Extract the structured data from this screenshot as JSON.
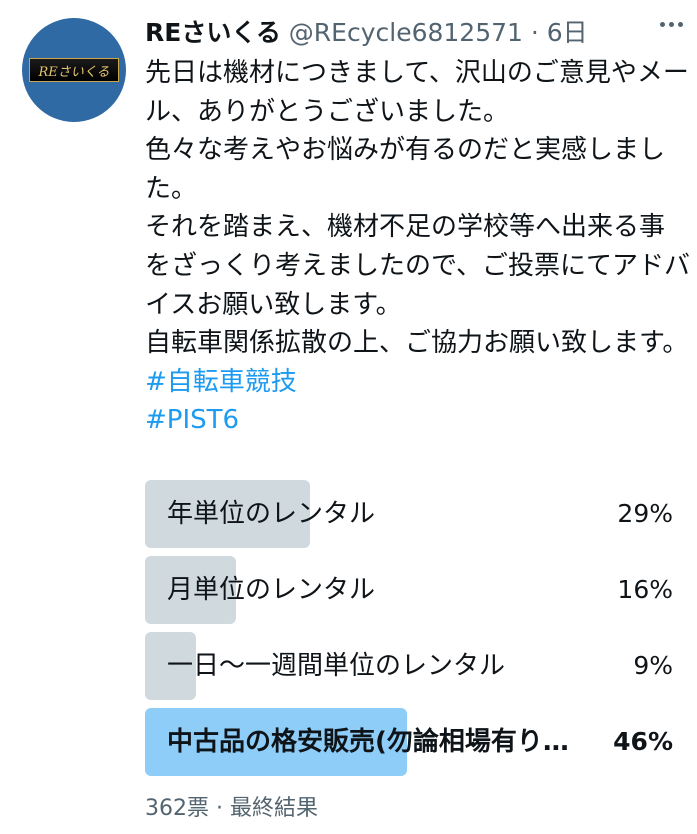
{
  "tweet": {
    "author_name": "REさいくる",
    "handle": "@REcycle6812571",
    "separator": " · ",
    "time": "6日",
    "avatar_text": "REさいくる",
    "paragraphs": [
      "先日は機材につきまして、沢山のご意見やメール、ありがとうございました。",
      "色々な考えやお悩みが有るのだと実感しました。",
      "それを踏まえ、機材不足の学校等へ出来る事をざっくり考えましたので、ご投票にてアドバイスお願い致します。",
      "自転車関係拡散の上、ご協力お願い致します。"
    ],
    "hashtags": [
      "#自転車競技",
      "#PIST6"
    ]
  },
  "poll": {
    "options": [
      {
        "label": "年単位のレンタル",
        "percent_text": "29%",
        "percent": 29,
        "winner": false
      },
      {
        "label": "月単位のレンタル",
        "percent_text": "16%",
        "percent": 16,
        "winner": false
      },
      {
        "label": "一日〜一週間単位のレンタル",
        "percent_text": "9%",
        "percent": 9,
        "winner": false
      },
      {
        "label": "中古品の格安販売(勿論相場有り…",
        "percent_text": "46%",
        "percent": 46,
        "winner": true
      }
    ],
    "footer": "362票 · 最終結果"
  },
  "colors": {
    "bar": "#cfd9de",
    "winner_bar": "#8ecdf8",
    "hashtag": "#1d9bf0",
    "secondary_text": "#536471"
  },
  "icons": {
    "more": "more-horizontal-icon"
  }
}
